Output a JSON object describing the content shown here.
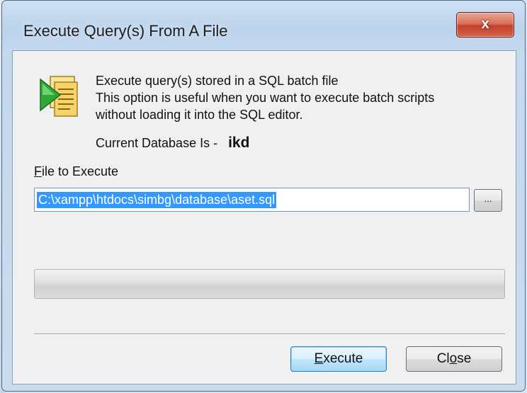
{
  "window": {
    "title": "Execute Query(s) From A File",
    "close_glyph": "x"
  },
  "icon": {
    "name": "sql-batch-file-icon",
    "accent": "#2fa836",
    "paper": "#f4d35e"
  },
  "description": {
    "line1": "Execute query(s) stored in a SQL batch file",
    "line2": "This option is useful when you want to execute batch scripts",
    "line3": "without loading it into the SQL editor."
  },
  "database": {
    "label": "Current Database Is -",
    "name": "ikd"
  },
  "file": {
    "label_mnemonic": "F",
    "label_rest": "ile to Execute",
    "value": "C:\\xampp\\htdocs\\simbg\\database\\aset.sql",
    "browse_label": "..."
  },
  "progress": {
    "value": 0
  },
  "buttons": {
    "execute_mnemonic": "E",
    "execute_rest": "xecute",
    "close_pre": "Cl",
    "close_mnemonic": "o",
    "close_post": "se"
  },
  "colors": {
    "selection": "#3399ff",
    "title_close": "#c4412b",
    "default_button": "#bee6fd"
  }
}
